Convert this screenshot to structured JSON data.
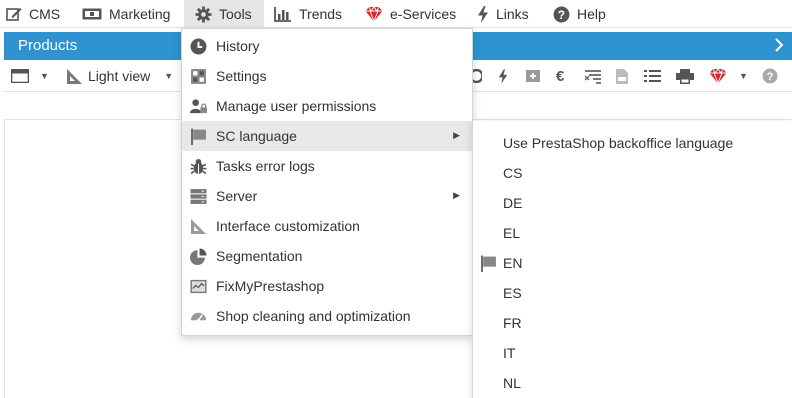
{
  "menubar": {
    "items": [
      {
        "label": "CMS",
        "icon": "edit-icon"
      },
      {
        "label": "Marketing",
        "icon": "banknote-icon"
      },
      {
        "label": "Tools",
        "icon": "gear-icon"
      },
      {
        "label": "Trends",
        "icon": "bar-chart-icon"
      },
      {
        "label": "e-Services",
        "icon": "ruby-gem-icon"
      },
      {
        "label": "Links",
        "icon": "bolt-icon"
      },
      {
        "label": "Help",
        "icon": "question-icon"
      }
    ]
  },
  "panel": {
    "title": "Products"
  },
  "toolbar": {
    "view_label": "Light view"
  },
  "tools_menu": {
    "items": [
      {
        "label": "History",
        "icon": "clock-icon"
      },
      {
        "label": "Settings",
        "icon": "settings-grid-icon"
      },
      {
        "label": "Manage user permissions",
        "icon": "user-lock-icon"
      },
      {
        "label": "SC language",
        "icon": "flag-icon",
        "has_submenu": true
      },
      {
        "label": "Tasks error logs",
        "icon": "bug-icon"
      },
      {
        "label": "Server",
        "icon": "server-icon",
        "has_submenu": true
      },
      {
        "label": "Interface customization",
        "icon": "ruler-icon"
      },
      {
        "label": "Segmentation",
        "icon": "pie-chart-icon"
      },
      {
        "label": "FixMyPrestashop",
        "icon": "monitor-chart-icon"
      },
      {
        "label": "Shop cleaning and optimization",
        "icon": "dashboard-gauge-icon"
      }
    ]
  },
  "language_submenu": {
    "items": [
      {
        "label": "Use PrestaShop backoffice language"
      },
      {
        "label": "CS"
      },
      {
        "label": "DE"
      },
      {
        "label": "EL"
      },
      {
        "label": "EN",
        "selected": true
      },
      {
        "label": "ES"
      },
      {
        "label": "FR"
      },
      {
        "label": "IT"
      },
      {
        "label": "NL"
      }
    ]
  },
  "colors": {
    "accent": "#2e93cf",
    "gem": "#d9262c",
    "icon_gray": "#555555"
  }
}
